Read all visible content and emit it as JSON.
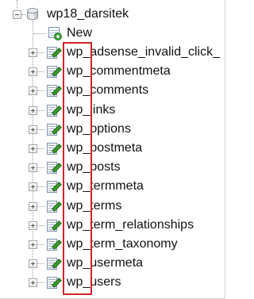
{
  "database": {
    "name": "wp18_darsitek",
    "icon": "database-icon",
    "expanded": true
  },
  "new_item": {
    "label": "New",
    "icon": "new-table-icon"
  },
  "tables": [
    {
      "label": "wp_adsense_invalid_click_"
    },
    {
      "label": "wp_commentmeta"
    },
    {
      "label": "wp_comments"
    },
    {
      "label": "wp_links"
    },
    {
      "label": "wp_options"
    },
    {
      "label": "wp_postmeta"
    },
    {
      "label": "wp_posts"
    },
    {
      "label": "wp_termmeta"
    },
    {
      "label": "wp_terms"
    },
    {
      "label": "wp_term_relationships"
    },
    {
      "label": "wp_term_taxonomy"
    },
    {
      "label": "wp_usermeta"
    },
    {
      "label": "wp_users"
    }
  ],
  "colors": {
    "highlight": "#d2232a",
    "text": "#111111",
    "tree_lines": "#9a9a9a"
  }
}
